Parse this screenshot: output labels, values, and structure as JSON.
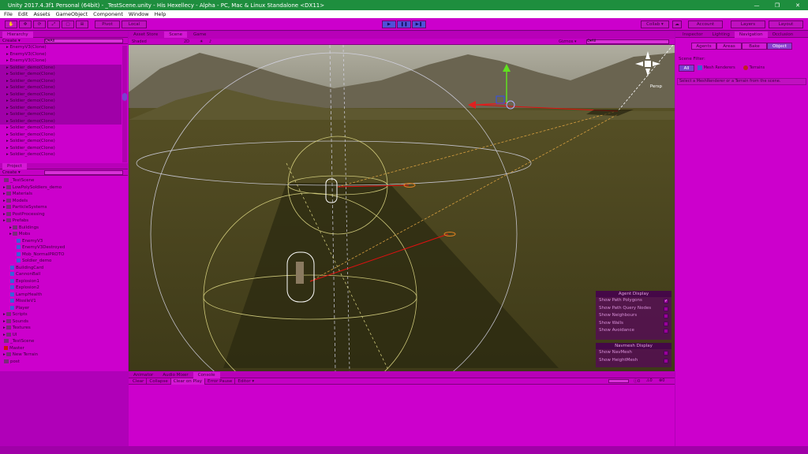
{
  "window": {
    "title": "Unity 2017.4.3f1 Personal (64bit) - _TestScene.unity - His Hexellecy - Alpha - PC, Mac & Linux Standalone <DX11>",
    "min": "—",
    "max": "❐",
    "close": "✕"
  },
  "menu": [
    "File",
    "Edit",
    "Assets",
    "GameObject",
    "Component",
    "Window",
    "Help"
  ],
  "toolbar": {
    "pivot": "Pivot",
    "local": "Local",
    "collab": "Collab ▾",
    "account": "Account",
    "layers": "Layers",
    "layout": "Layout"
  },
  "hierarchy": {
    "tab": "Hierarchy",
    "create": "Create ▾",
    "search": "Q▾All",
    "items": [
      {
        "label": "EnemyV3(Clone)",
        "sel": false
      },
      {
        "label": "EnemyV3(Clone)",
        "sel": false
      },
      {
        "label": "EnemyV3(Clone)",
        "sel": false
      },
      {
        "label": "Soldier_demo(Clone)",
        "sel": true
      },
      {
        "label": "Soldier_demo(Clone)",
        "sel": true
      },
      {
        "label": "Soldier_demo(Clone)",
        "sel": true
      },
      {
        "label": "Soldier_demo(Clone)",
        "sel": true
      },
      {
        "label": "Soldier_demo(Clone)",
        "sel": true
      },
      {
        "label": "Soldier_demo(Clone)",
        "sel": true
      },
      {
        "label": "Soldier_demo(Clone)",
        "sel": true
      },
      {
        "label": "Soldier_demo(Clone)",
        "sel": true
      },
      {
        "label": "Soldier_demo(Clone)",
        "sel": true
      },
      {
        "label": "Soldier_demo(Clone)",
        "sel": false
      },
      {
        "label": "Soldier_demo(Clone)",
        "sel": false
      },
      {
        "label": "Soldier_demo(Clone)",
        "sel": false
      },
      {
        "label": "Soldier_demo(Clone)",
        "sel": false
      },
      {
        "label": "Soldier_demo(Clone)",
        "sel": false
      }
    ]
  },
  "project": {
    "tab": "Project",
    "create": "Create ▾",
    "items": [
      {
        "label": "_TestScene",
        "icon": "scene",
        "indent": 0
      },
      {
        "label": "LowPolySoldiers_demo",
        "icon": "folder",
        "indent": 0
      },
      {
        "label": "Materials",
        "icon": "folder",
        "indent": 0
      },
      {
        "label": "Models",
        "icon": "folder",
        "indent": 0
      },
      {
        "label": "ParticleSystems",
        "icon": "folder",
        "indent": 0
      },
      {
        "label": "PostProcessing",
        "icon": "folder",
        "indent": 0
      },
      {
        "label": "Prefabs",
        "icon": "folder",
        "indent": 0
      },
      {
        "label": "Buildings",
        "icon": "folder",
        "indent": 1
      },
      {
        "label": "Mobs",
        "icon": "folder",
        "indent": 1
      },
      {
        "label": "EnemyV3",
        "icon": "prefab",
        "indent": 2
      },
      {
        "label": "EnemyV3Destroyed",
        "icon": "prefab",
        "indent": 2
      },
      {
        "label": "Mob_NormalPROTO",
        "icon": "prefab",
        "indent": 2
      },
      {
        "label": "Soldier_demo",
        "icon": "prefab",
        "indent": 2
      },
      {
        "label": "BuildingCard",
        "icon": "prefab",
        "indent": 1
      },
      {
        "label": "CannonBall",
        "icon": "prefab",
        "indent": 1
      },
      {
        "label": "Explosion1",
        "icon": "prefab",
        "indent": 1
      },
      {
        "label": "Explosion2",
        "icon": "prefab",
        "indent": 1
      },
      {
        "label": "LampHealth",
        "icon": "prefab",
        "indent": 1
      },
      {
        "label": "MissileV1",
        "icon": "prefab",
        "indent": 1
      },
      {
        "label": "Player",
        "icon": "prefab",
        "indent": 1
      },
      {
        "label": "Scripts",
        "icon": "folder",
        "indent": 0
      },
      {
        "label": "Sounds",
        "icon": "folder",
        "indent": 0
      },
      {
        "label": "Textures",
        "icon": "folder",
        "indent": 0
      },
      {
        "label": "UI",
        "icon": "folder",
        "indent": 0
      },
      {
        "label": "_TestScene",
        "icon": "scene",
        "indent": 0
      },
      {
        "label": "Master",
        "icon": "red",
        "indent": 0
      },
      {
        "label": "New Terrain",
        "icon": "folder",
        "indent": 0
      },
      {
        "label": "post",
        "icon": "file",
        "indent": 0
      }
    ]
  },
  "scene": {
    "tabs": [
      "Asset Store",
      "Scene",
      "Game"
    ],
    "shading": "Shaded",
    "mode2d": "2D",
    "gizmos": "Gizmos ▾",
    "search": "Q▾All",
    "persp": "Persp"
  },
  "agent_display": {
    "title": "Agent Display",
    "items": [
      "Show Path Polygons",
      "Show Path Query Nodes",
      "Show Neighbours",
      "Show Walls",
      "Show Avoidance"
    ]
  },
  "navmesh_display": {
    "title": "Navmesh Display",
    "items": [
      "Show NavMesh",
      "Show HeightMesh"
    ]
  },
  "inspector": {
    "tabs": [
      "Inspector",
      "Lighting",
      "Navigation",
      "Occlusion"
    ],
    "subtabs": [
      "Agents",
      "Areas",
      "Bake",
      "Object"
    ],
    "filter_label": "Scene Filter:",
    "filters": [
      "All",
      "Mesh Renderers",
      "Terrains"
    ],
    "hint": "Select a MeshRenderer or a Terrain from the scene."
  },
  "console": {
    "tabs": [
      "Animator",
      "Audio Mixer",
      "Console"
    ],
    "buttons": [
      "Clear",
      "Collapse",
      "Clear on Play",
      "Error Pause",
      "Editor ▾"
    ],
    "counts": [
      "0",
      "0",
      "0"
    ]
  },
  "colors": {
    "magenta": "#cc00cc",
    "title_green": "#1e8e3e",
    "ground": "#4a4520",
    "sky": "#9a9a8a"
  }
}
